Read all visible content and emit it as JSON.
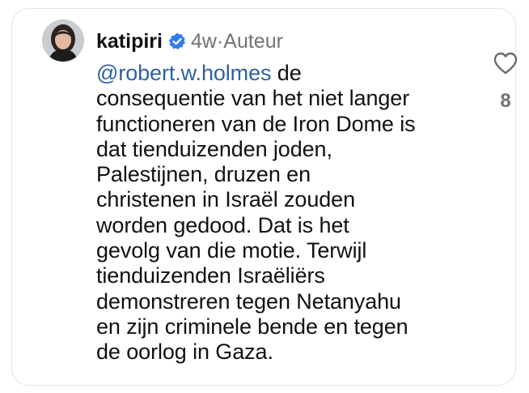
{
  "comment": {
    "username": "katipiri",
    "timestamp": "4w",
    "separator": "·",
    "role": "Auteur",
    "mention": "@robert.w.holmes",
    "first_line_rest": " de",
    "lines": [
      "consequentie van het niet langer",
      "functioneren van de Iron Dome is",
      "dat tienduizenden joden,",
      "Palestijnen, druzen en",
      "christenen in Israël zouden",
      "worden gedood. Dat is het",
      "gevolg van die motie. Terwijl",
      "tienduizenden Israëliërs",
      "demonstreren tegen Netanyahu",
      "en zijn criminele bende en tegen",
      "de oorlog in Gaza."
    ]
  },
  "likes": {
    "count": "8",
    "icon": "heart-outline-icon"
  },
  "colors": {
    "mention": "#2e5fa3",
    "meta": "#737373",
    "verified": "#2f7bf0",
    "text": "#111111"
  }
}
